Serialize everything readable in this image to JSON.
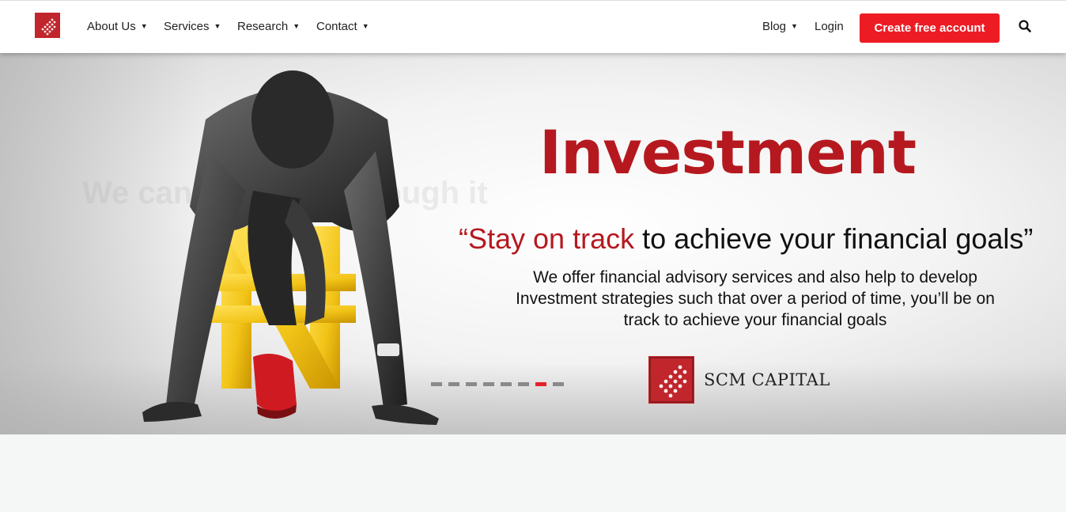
{
  "nav": {
    "items": [
      {
        "label": "About Us",
        "caret": "▼"
      },
      {
        "label": "Services",
        "caret": "▼"
      },
      {
        "label": "Research",
        "caret": "▼"
      },
      {
        "label": "Contact",
        "caret": "▼"
      }
    ],
    "blog": {
      "label": "Blog",
      "caret": "▼"
    },
    "login": "Login",
    "cta": "Create free account",
    "search_icon": "search-icon"
  },
  "hero": {
    "ghost_title": "We can help you through it",
    "title": "Investment",
    "tagline_open": "“",
    "tagline_accent": "Stay on track",
    "tagline_rest": " to achieve your financial goals”",
    "description": "We offer financial advisory services and also help to develop Investment strategies such that over a period of time, you’ll be on track to achieve your financial goals",
    "brand_name": "SCM CAPITAL",
    "slides": {
      "count": 8,
      "active": 7
    },
    "colors": {
      "accent": "#b5191f",
      "dot_active": "#e62129",
      "dot": "#8a8a8a"
    }
  }
}
